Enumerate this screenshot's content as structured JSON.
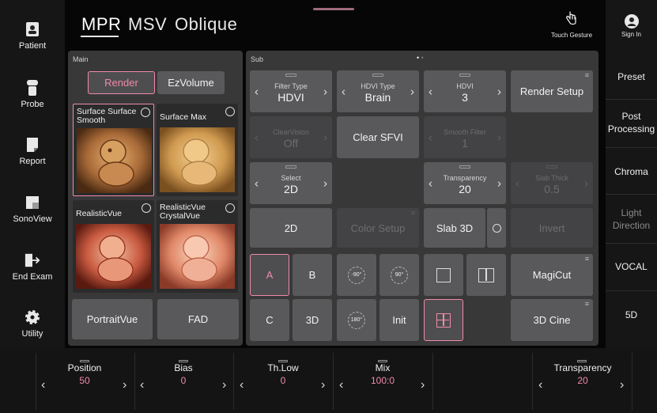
{
  "left_nav": [
    {
      "label": "Patient",
      "icon": "patient-icon"
    },
    {
      "label": "Probe",
      "icon": "probe-icon"
    },
    {
      "label": "Report",
      "icon": "report-icon"
    },
    {
      "label": "SonoView",
      "icon": "sonoview-icon"
    },
    {
      "label": "End Exam",
      "icon": "end-exam-icon"
    },
    {
      "label": "Utility",
      "icon": "gear-icon"
    }
  ],
  "tabs": [
    {
      "label": "MPR",
      "active": true
    },
    {
      "label": "MSV",
      "active": false
    },
    {
      "label": "Oblique",
      "active": false
    }
  ],
  "touch_gesture": {
    "label": "Touch Gesture",
    "icon": "hand-pointer-icon"
  },
  "sign_in": {
    "label": "Sign In",
    "icon": "user-avatar-icon"
  },
  "right_nav": [
    {
      "label": "Preset",
      "enabled": true
    },
    {
      "label": "Post Processing",
      "enabled": true
    },
    {
      "label": "Chroma",
      "enabled": true
    },
    {
      "label": "Light Direction",
      "enabled": false
    },
    {
      "label": "VOCAL",
      "enabled": true
    },
    {
      "label": "5D",
      "enabled": true
    }
  ],
  "main_panel": {
    "title": "Main",
    "mode_buttons": [
      {
        "label": "Render",
        "selected": true
      },
      {
        "label": "EzVolume",
        "selected": false
      }
    ],
    "thumbnails": [
      {
        "label": "Surface Surface Smooth",
        "selected": true
      },
      {
        "label": "Surface Max",
        "selected": false
      },
      {
        "label": "RealisticVue",
        "selected": false
      },
      {
        "label": "RealisticVue CrystalVue",
        "selected": false
      }
    ],
    "bottom_buttons": [
      {
        "label": "PortraitVue"
      },
      {
        "label": "FAD"
      }
    ]
  },
  "sub_panel": {
    "title": "Sub",
    "page_dots": [
      "•",
      "•"
    ],
    "filter_type": {
      "label": "Filter Type",
      "value": "HDVI"
    },
    "hdvi_type": {
      "label": "HDVI Type",
      "value": "Brain"
    },
    "hdvi": {
      "label": "HDVI",
      "value": "3"
    },
    "render_setup": "Render Setup",
    "clear_vision": {
      "label": "ClearVision",
      "value": "Off"
    },
    "clear_sfvi": "Clear SFVI",
    "smooth_filter": {
      "label": "Smooth Filter",
      "value": "1"
    },
    "select": {
      "label": "Select",
      "value": "2D"
    },
    "transparency": {
      "label": "Transparency",
      "value": "20"
    },
    "slab_thick": {
      "label": "Slab Thick",
      "value": "0.5"
    },
    "btn_2d": "2D",
    "color_setup": "Color Setup",
    "slab_3d": "Slab 3D",
    "invert": "Invert",
    "a": "A",
    "b": "B",
    "c": "C",
    "btn_3d": "3D",
    "rot_neg90": "-90°",
    "rot_90": "90°",
    "rot_180": "180°",
    "init": "Init",
    "magicut": "MagiCut",
    "cine_3d": "3D Cine",
    "menu_glyph": "≡"
  },
  "bottom_controls": [
    {
      "label": "Position",
      "value": "50"
    },
    {
      "label": "Bias",
      "value": "0"
    },
    {
      "label": "Th.Low",
      "value": "0"
    },
    {
      "label": "Mix",
      "value": "100:0"
    },
    {
      "label": "Transparency",
      "value": "20"
    }
  ],
  "colors": {
    "accent": "#f08aa8",
    "panel": "#383839",
    "button": "#59595b",
    "background": "#060606"
  }
}
